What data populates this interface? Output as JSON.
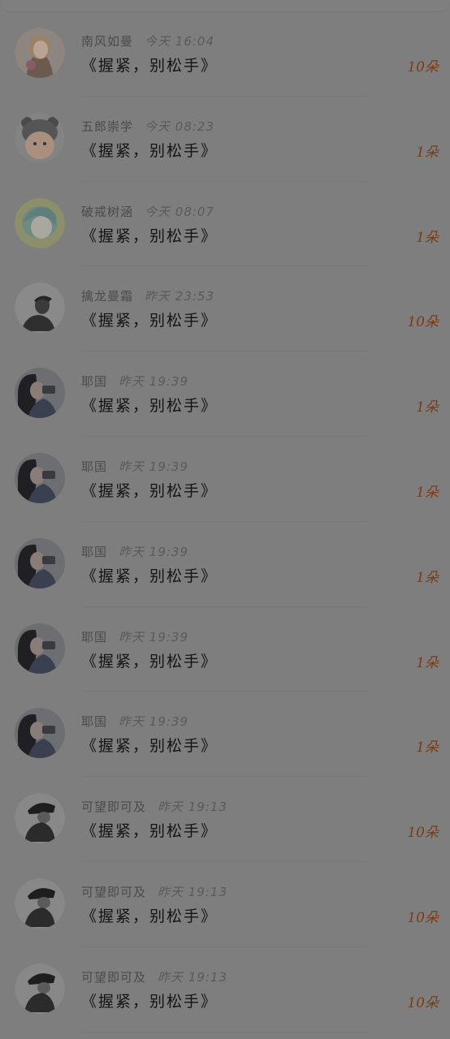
{
  "items": [
    {
      "name": "南风如曼",
      "time": "今天 16:04",
      "title": "《握紧，别松手》",
      "count": "10朵",
      "avatar_icon": "girl-illustration-avatar"
    },
    {
      "name": "五郎崇学",
      "time": "今天 08:23",
      "title": "《握紧，别松手》",
      "count": "1朵",
      "avatar_icon": "baby-bear-hat-avatar"
    },
    {
      "name": "破戒树涵",
      "time": "今天 08:07",
      "title": "《握紧，别松手》",
      "count": "1朵",
      "avatar_icon": "anime-boy-avatar"
    },
    {
      "name": "擒龙曼霜",
      "time": "昨天 23:53",
      "title": "《握紧，别松手》",
      "count": "10朵",
      "avatar_icon": "person-cap-avatar"
    },
    {
      "name": "耶国",
      "time": "昨天 19:39",
      "title": "《握紧，别松手》",
      "count": "1朵",
      "avatar_icon": "girl-camera-avatar"
    },
    {
      "name": "耶国",
      "time": "昨天 19:39",
      "title": "《握紧，别松手》",
      "count": "1朵",
      "avatar_icon": "girl-camera-avatar"
    },
    {
      "name": "耶国",
      "time": "昨天 19:39",
      "title": "《握紧，别松手》",
      "count": "1朵",
      "avatar_icon": "girl-camera-avatar"
    },
    {
      "name": "耶国",
      "time": "昨天 19:39",
      "title": "《握紧，别松手》",
      "count": "1朵",
      "avatar_icon": "girl-camera-avatar"
    },
    {
      "name": "耶国",
      "time": "昨天 19:39",
      "title": "《握紧，别松手》",
      "count": "1朵",
      "avatar_icon": "girl-camera-avatar"
    },
    {
      "name": "可望即可及",
      "time": "昨天 19:13",
      "title": "《握紧，别松手》",
      "count": "10朵",
      "avatar_icon": "cyclist-helmet-avatar"
    },
    {
      "name": "可望即可及",
      "time": "昨天 19:13",
      "title": "《握紧，别松手》",
      "count": "10朵",
      "avatar_icon": "cyclist-helmet-avatar"
    },
    {
      "name": "可望即可及",
      "time": "昨天 19:13",
      "title": "《握紧，别松手》",
      "count": "10朵",
      "avatar_icon": "cyclist-helmet-avatar"
    }
  ],
  "colors": {
    "background": "#7e7e7e",
    "count_text": "#7d3a13",
    "title_text": "#141414",
    "meta_text": "#4b4b4b"
  }
}
